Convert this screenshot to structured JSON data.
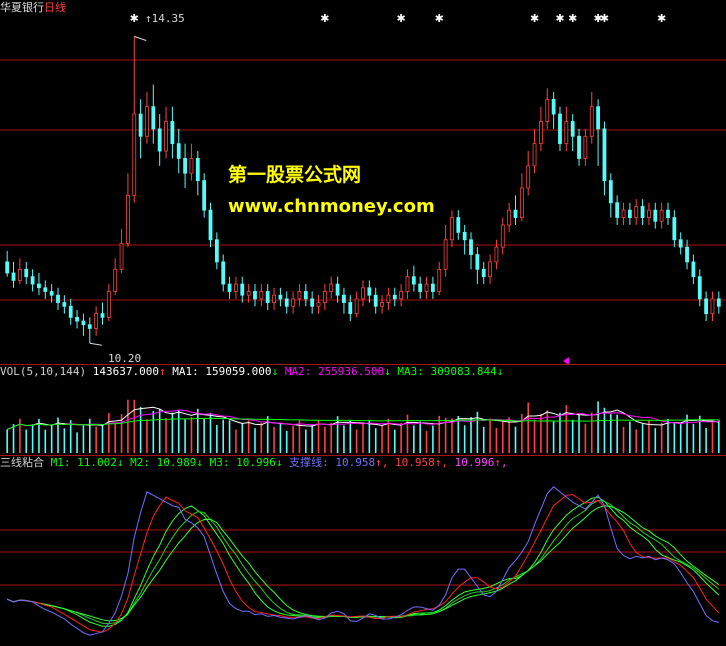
{
  "chart_title": {
    "name": "华夏银行",
    "period": "日线"
  },
  "price": {
    "high_label": "14.35",
    "low_label": "10.20",
    "ylim": [
      10.0,
      14.6
    ]
  },
  "volume_header": {
    "label": "VOL(5,10,144)",
    "value": "143637.000",
    "value_arrow": "↑",
    "ma1_label": "MA1:",
    "ma1_value": "159059.000",
    "ma1_arrow": "↓",
    "ma2_label": "MA2:",
    "ma2_value": "255936.500",
    "ma2_arrow": "↓",
    "ma3_label": "MA3:",
    "ma3_value": "309083.844",
    "ma3_arrow": "↓"
  },
  "indicator_header": {
    "label": "三线粘合",
    "m1_label": "M1:",
    "m1_value": "11.002",
    "m1_arrow": "↓",
    "m2_label": "M2:",
    "m2_value": "10.989",
    "m2_arrow": "↓",
    "m3_label": "M3:",
    "m3_value": "10.996",
    "m3_arrow": "↓",
    "support_label": "支撑线:",
    "support_value": "10.958",
    "support_arrow": "↑",
    "v5": "10.958",
    "v5_arrow": "↑",
    "v6": "10.996",
    "v6_arrow": "↑",
    "trail": ","
  },
  "watermark": {
    "line1": "第一股票公式网",
    "line2": "www.chnmoney.com"
  },
  "colors": {
    "up": "#ff4040",
    "down": "#54fcfc",
    "grid": "#aa1111",
    "ma1": "#ffffff",
    "ma2": "#ff00ff",
    "ma3": "#00ff00",
    "red_line": "#ff2020",
    "blue_line": "#7070ff",
    "green_band": "#30ff30",
    "watermark": "#ffff00"
  },
  "chart_data": {
    "type": "candlestick",
    "candles": [
      [
        11.3,
        11.15,
        11.45,
        11.1
      ],
      [
        11.15,
        11.05,
        11.3,
        10.95
      ],
      [
        11.05,
        11.2,
        11.35,
        11.0
      ],
      [
        11.2,
        11.1,
        11.3,
        11.0
      ],
      [
        11.1,
        11.0,
        11.2,
        10.9
      ],
      [
        11.0,
        10.95,
        11.15,
        10.85
      ],
      [
        10.95,
        10.9,
        11.05,
        10.8
      ],
      [
        10.9,
        10.85,
        11.0,
        10.75
      ],
      [
        10.85,
        10.75,
        10.95,
        10.65
      ],
      [
        10.75,
        10.7,
        10.85,
        10.6
      ],
      [
        10.7,
        10.55,
        10.8,
        10.45
      ],
      [
        10.55,
        10.5,
        10.65,
        10.4
      ],
      [
        10.5,
        10.45,
        10.6,
        10.3
      ],
      [
        10.45,
        10.4,
        10.55,
        10.2
      ],
      [
        10.4,
        10.6,
        10.7,
        10.3
      ],
      [
        10.6,
        10.55,
        10.75,
        10.45
      ],
      [
        10.55,
        10.9,
        11.0,
        10.5
      ],
      [
        10.9,
        11.2,
        11.35,
        10.85
      ],
      [
        11.2,
        11.55,
        11.75,
        11.15
      ],
      [
        11.55,
        12.2,
        12.5,
        11.5
      ],
      [
        12.2,
        13.3,
        14.35,
        12.1
      ],
      [
        13.3,
        13.0,
        13.5,
        12.7
      ],
      [
        13.0,
        13.4,
        13.6,
        12.9
      ],
      [
        13.4,
        13.1,
        13.7,
        12.9
      ],
      [
        13.1,
        12.8,
        13.3,
        12.6
      ],
      [
        12.8,
        13.2,
        13.4,
        12.7
      ],
      [
        13.2,
        12.9,
        13.4,
        12.7
      ],
      [
        12.9,
        12.7,
        13.1,
        12.5
      ],
      [
        12.7,
        12.5,
        12.9,
        12.3
      ],
      [
        12.5,
        12.7,
        12.9,
        12.4
      ],
      [
        12.7,
        12.4,
        12.8,
        12.2
      ],
      [
        12.4,
        12.0,
        12.5,
        11.9
      ],
      [
        12.0,
        11.6,
        12.1,
        11.5
      ],
      [
        11.6,
        11.3,
        11.7,
        11.2
      ],
      [
        11.3,
        11.0,
        11.4,
        10.9
      ],
      [
        11.0,
        10.9,
        11.1,
        10.8
      ],
      [
        10.9,
        11.0,
        11.1,
        10.8
      ],
      [
        11.0,
        10.85,
        11.1,
        10.75
      ],
      [
        10.85,
        10.9,
        11.0,
        10.75
      ],
      [
        10.9,
        10.8,
        11.0,
        10.7
      ],
      [
        10.8,
        10.9,
        11.0,
        10.7
      ],
      [
        10.9,
        10.75,
        11.0,
        10.65
      ],
      [
        10.75,
        10.85,
        10.95,
        10.65
      ],
      [
        10.85,
        10.8,
        10.95,
        10.7
      ],
      [
        10.8,
        10.7,
        10.9,
        10.6
      ],
      [
        10.7,
        10.8,
        10.9,
        10.6
      ],
      [
        10.8,
        10.9,
        11.0,
        10.7
      ],
      [
        10.9,
        10.8,
        11.0,
        10.7
      ],
      [
        10.8,
        10.7,
        10.9,
        10.6
      ],
      [
        10.7,
        10.75,
        10.85,
        10.6
      ],
      [
        10.75,
        10.9,
        11.0,
        10.65
      ],
      [
        10.9,
        11.0,
        11.1,
        10.8
      ],
      [
        11.0,
        10.85,
        11.1,
        10.75
      ],
      [
        10.85,
        10.75,
        10.95,
        10.6
      ],
      [
        10.75,
        10.6,
        10.85,
        10.5
      ],
      [
        10.6,
        10.8,
        10.9,
        10.55
      ],
      [
        10.8,
        10.95,
        11.05,
        10.7
      ],
      [
        10.95,
        10.85,
        11.05,
        10.75
      ],
      [
        10.85,
        10.7,
        10.95,
        10.6
      ],
      [
        10.7,
        10.75,
        10.85,
        10.6
      ],
      [
        10.75,
        10.85,
        10.95,
        10.65
      ],
      [
        10.85,
        10.8,
        10.95,
        10.7
      ],
      [
        10.8,
        10.9,
        11.0,
        10.7
      ],
      [
        10.9,
        11.1,
        11.2,
        10.8
      ],
      [
        11.1,
        11.0,
        11.25,
        10.9
      ],
      [
        11.0,
        10.9,
        11.1,
        10.8
      ],
      [
        10.9,
        11.0,
        11.1,
        10.8
      ],
      [
        11.0,
        10.9,
        11.1,
        10.8
      ],
      [
        10.9,
        11.2,
        11.3,
        10.85
      ],
      [
        11.2,
        11.6,
        11.8,
        11.1
      ],
      [
        11.6,
        11.9,
        12.0,
        11.5
      ],
      [
        11.9,
        11.7,
        12.0,
        11.6
      ],
      [
        11.7,
        11.6,
        11.8,
        11.4
      ],
      [
        11.6,
        11.4,
        11.7,
        11.2
      ],
      [
        11.4,
        11.2,
        11.5,
        11.0
      ],
      [
        11.2,
        11.1,
        11.3,
        11.0
      ],
      [
        11.1,
        11.3,
        11.4,
        11.0
      ],
      [
        11.3,
        11.5,
        11.6,
        11.2
      ],
      [
        11.5,
        11.8,
        11.9,
        11.4
      ],
      [
        11.8,
        12.0,
        12.1,
        11.7
      ],
      [
        12.0,
        11.9,
        12.2,
        11.8
      ],
      [
        11.9,
        12.3,
        12.5,
        11.85
      ],
      [
        12.3,
        12.6,
        12.8,
        12.2
      ],
      [
        12.6,
        12.9,
        13.1,
        12.5
      ],
      [
        12.9,
        13.2,
        13.4,
        12.8
      ],
      [
        13.2,
        13.5,
        13.65,
        13.1
      ],
      [
        13.5,
        13.3,
        13.6,
        13.1
      ],
      [
        13.3,
        12.9,
        13.4,
        12.8
      ],
      [
        12.9,
        13.2,
        13.4,
        12.8
      ],
      [
        13.2,
        13.0,
        13.3,
        12.8
      ],
      [
        13.0,
        12.7,
        13.1,
        12.6
      ],
      [
        12.7,
        13.0,
        13.1,
        12.6
      ],
      [
        13.0,
        13.4,
        13.6,
        12.9
      ],
      [
        13.4,
        13.1,
        13.5,
        12.6
      ],
      [
        13.1,
        12.4,
        13.2,
        12.2
      ],
      [
        12.4,
        12.1,
        12.5,
        11.9
      ],
      [
        12.1,
        11.9,
        12.2,
        11.8
      ],
      [
        11.9,
        12.0,
        12.1,
        11.8
      ],
      [
        12.0,
        11.9,
        12.1,
        11.8
      ],
      [
        11.9,
        12.05,
        12.15,
        11.8
      ],
      [
        12.05,
        11.9,
        12.15,
        11.8
      ],
      [
        11.9,
        12.0,
        12.1,
        11.8
      ],
      [
        12.0,
        11.85,
        12.1,
        11.75
      ],
      [
        11.85,
        12.0,
        12.1,
        11.75
      ],
      [
        12.0,
        11.9,
        12.1,
        11.8
      ],
      [
        11.9,
        11.6,
        12.0,
        11.5
      ],
      [
        11.6,
        11.5,
        11.7,
        11.4
      ],
      [
        11.5,
        11.3,
        11.6,
        11.2
      ],
      [
        11.3,
        11.1,
        11.4,
        11.0
      ],
      [
        11.1,
        10.8,
        11.2,
        10.7
      ],
      [
        10.8,
        10.6,
        10.9,
        10.5
      ],
      [
        10.6,
        10.8,
        10.9,
        10.5
      ],
      [
        10.8,
        10.7,
        10.9,
        10.6
      ]
    ],
    "marker_candles": [
      20,
      50,
      62,
      68,
      83,
      87,
      89,
      93,
      94,
      103
    ]
  }
}
